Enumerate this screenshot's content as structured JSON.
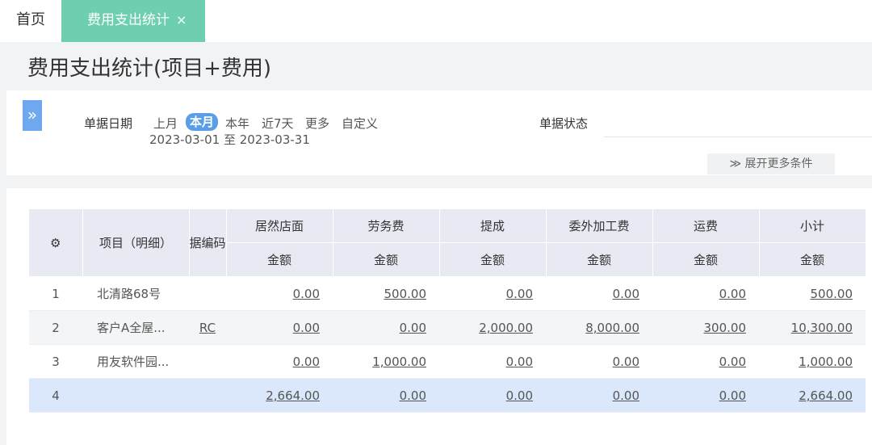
{
  "tabs": {
    "home": "首页",
    "active": "费用支出统计",
    "close": "×"
  },
  "page": {
    "title": "费用支出统计(项目+费用)"
  },
  "filter": {
    "toggle_icon": "»",
    "date_label": "单据日期",
    "date_options": [
      "上月",
      "本月",
      "本年",
      "近7天",
      "更多",
      "自定义"
    ],
    "active_option": "本月",
    "date_range": "2023-03-01 至 2023-03-31",
    "status_label": "单据状态",
    "expand_icon": "≫",
    "expand_label": "展开更多条件"
  },
  "table": {
    "settings_icon": "⚙",
    "col_project": "项目（明细）",
    "col_code": "据编码",
    "groups": [
      "居然店面",
      "劳务费",
      "提成",
      "委外加工费",
      "运费",
      "小计"
    ],
    "sub_header": "金额",
    "rows": [
      {
        "idx": "1",
        "name": "北清路68号",
        "code": "",
        "values": [
          "0.00",
          "500.00",
          "0.00",
          "0.00",
          "0.00",
          "500.00"
        ]
      },
      {
        "idx": "2",
        "name": "客户A全屋...",
        "code": "RC",
        "values": [
          "0.00",
          "0.00",
          "2,000.00",
          "8,000.00",
          "300.00",
          "10,300.00"
        ]
      },
      {
        "idx": "3",
        "name": "用友软件园...",
        "code": "",
        "values": [
          "0.00",
          "1,000.00",
          "0.00",
          "0.00",
          "0.00",
          "1,000.00"
        ]
      },
      {
        "idx": "4",
        "name": "",
        "code": "",
        "values": [
          "2,664.00",
          "0.00",
          "0.00",
          "0.00",
          "0.00",
          "2,664.00"
        ]
      }
    ]
  },
  "colors": {
    "active_tab": "#6dcfb0",
    "toggle": "#6ea8ef",
    "header_bg": "#e8eaf3",
    "selected_row": "#dbe8fb"
  }
}
